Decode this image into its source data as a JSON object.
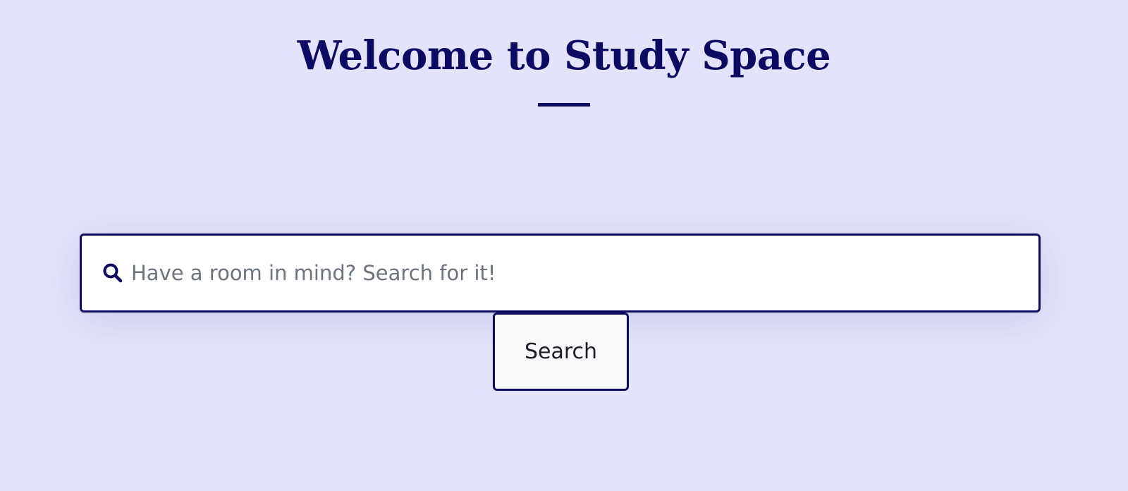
{
  "header": {
    "title": "Welcome to Study Space"
  },
  "search": {
    "placeholder": "Have a room in mind? Search for it!",
    "value": "",
    "icon": "search-icon",
    "button_label": "Search"
  },
  "colors": {
    "background": "#e3e3fc",
    "accent": "#0d0a63",
    "input_background": "#ffffff",
    "button_background": "#f8f9fb",
    "placeholder_text": "#6c737e"
  }
}
